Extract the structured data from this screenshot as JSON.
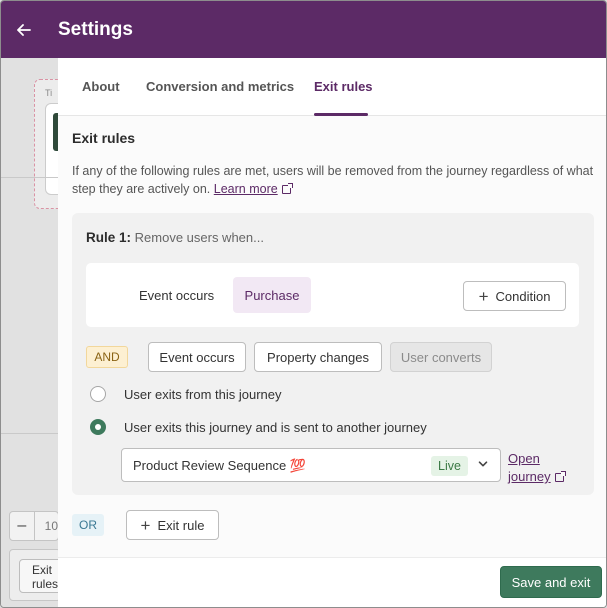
{
  "header": {
    "title": "Settings",
    "back_icon": "arrow-left-icon"
  },
  "background": {
    "title_stub": "Ti",
    "zoom_value": "10",
    "exit_rules_button": "Exit rules"
  },
  "tabs": [
    {
      "label": "About",
      "active": false
    },
    {
      "label": "Conversion and metrics",
      "active": false
    },
    {
      "label": "Exit rules",
      "active": true
    }
  ],
  "section": {
    "title": "Exit rules",
    "description": "If any of the following rules are met, users will be removed from the journey regardless of what step they are actively on.",
    "learn_more": "Learn more"
  },
  "rule": {
    "number_label": "Rule 1:",
    "subtitle": "Remove users when...",
    "condition": {
      "label": "Event occurs",
      "value": "Purchase",
      "add_condition_label": "Condition"
    },
    "and_label": "AND",
    "options": [
      "Event occurs",
      "Property changes",
      "User converts"
    ],
    "radio_options": [
      {
        "label": "User exits from this journey",
        "checked": false
      },
      {
        "label": "User exits this journey and is sent to another journey",
        "checked": true
      }
    ],
    "journey_select": {
      "value": "Product Review Sequence 💯",
      "status": "Live"
    },
    "open_journey": "Open journey"
  },
  "or_label": "OR",
  "add_exit_rule_label": "Exit rule",
  "footer": {
    "save_label": "Save and exit"
  },
  "colors": {
    "brand": "#5c2a66",
    "primary_button": "#3e7a5d"
  }
}
